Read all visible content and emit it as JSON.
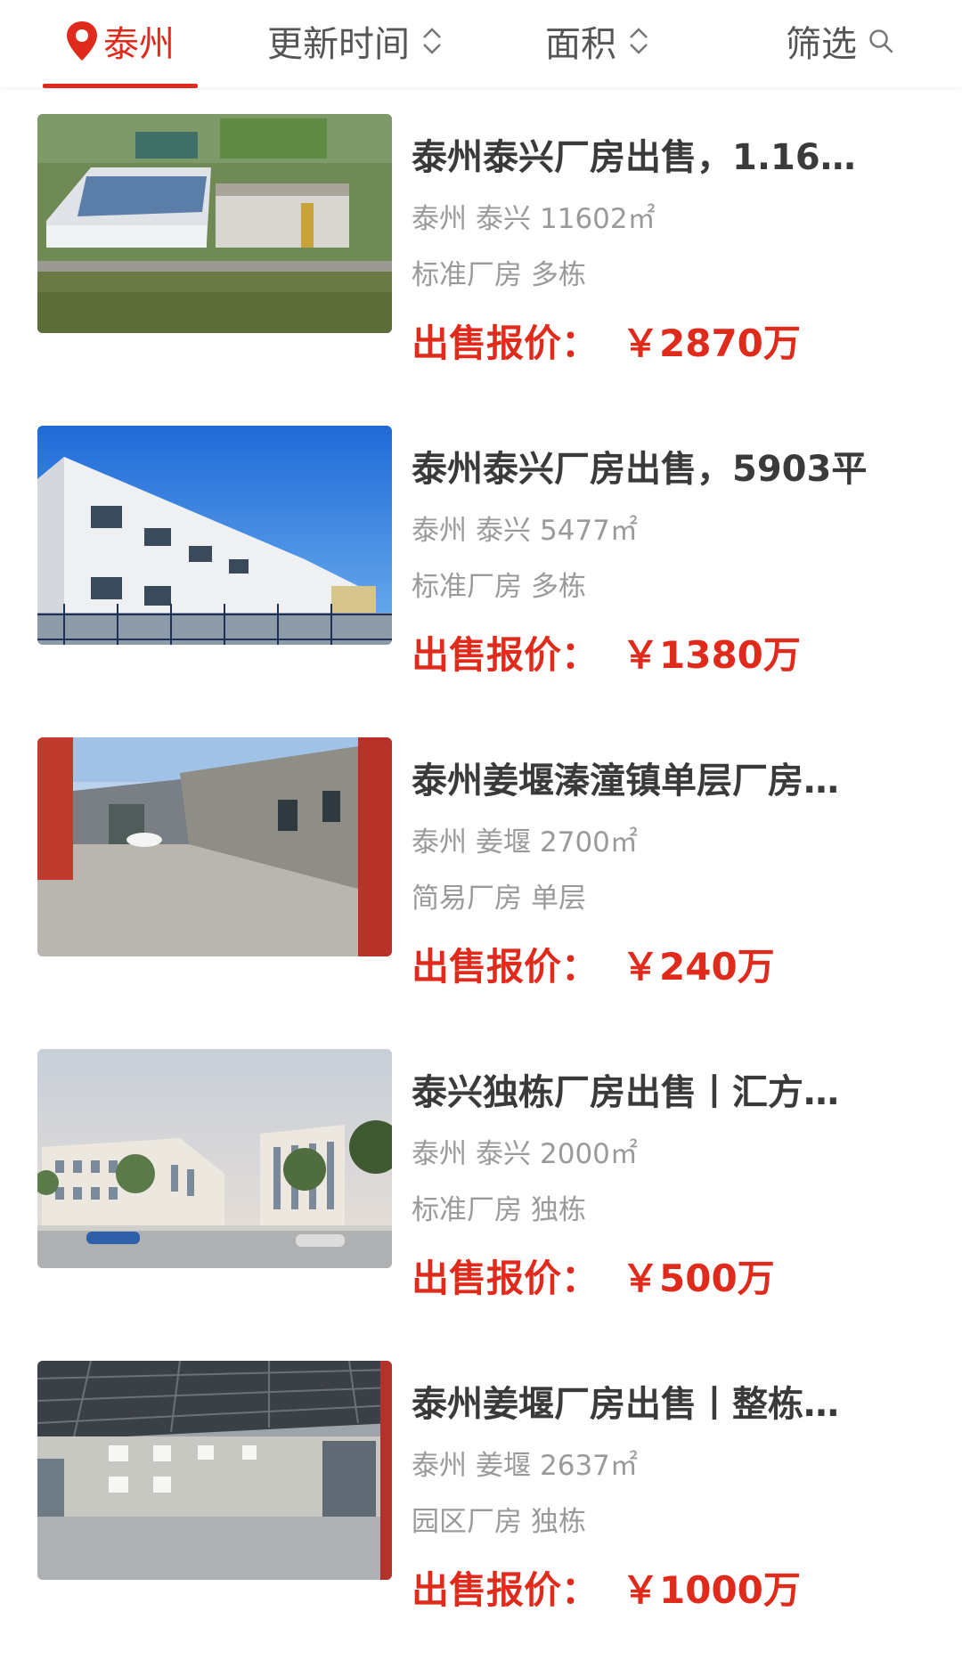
{
  "header": {
    "city": "泰州",
    "sort_update": "更新时间",
    "sort_area": "面积",
    "filter": "筛选"
  },
  "colors": {
    "accent": "#e02a1c",
    "title": "#3a3a3a",
    "meta": "#9a9a9a"
  },
  "listings": [
    {
      "title": "泰州泰兴厂房出售，1.16…",
      "city": "泰州",
      "district": "泰兴",
      "area": "11602㎡",
      "type": "标准厂房",
      "floors": "多栋",
      "price_label": "出售报价：",
      "price": "￥2870万",
      "image": "aerial-factory-photo"
    },
    {
      "title": "泰州泰兴厂房出售，5903平",
      "city": "泰州",
      "district": "泰兴",
      "area": "5477㎡",
      "type": "标准厂房",
      "floors": "多栋",
      "price_label": "出售报价：",
      "price": "￥1380万",
      "image": "white-factory-building-photo"
    },
    {
      "title": "泰州姜堰溱潼镇单层厂房…",
      "city": "泰州",
      "district": "姜堰",
      "area": "2700㎡",
      "type": "简易厂房",
      "floors": "单层",
      "price_label": "出售报价：",
      "price": "￥240万",
      "image": "factory-yard-photo"
    },
    {
      "title": "泰兴独栋厂房出售丨汇方…",
      "city": "泰州",
      "district": "泰兴",
      "area": "2000㎡",
      "type": "标准厂房",
      "floors": "独栋",
      "price_label": "出售报价：",
      "price": "￥500万",
      "image": "industrial-park-rendering"
    },
    {
      "title": "泰州姜堰厂房出售丨整栋…",
      "city": "泰州",
      "district": "姜堰",
      "area": "2637㎡",
      "type": "园区厂房",
      "floors": "独栋",
      "price_label": "出售报价：",
      "price": "￥1000万",
      "image": "warehouse-interior-photo"
    }
  ]
}
